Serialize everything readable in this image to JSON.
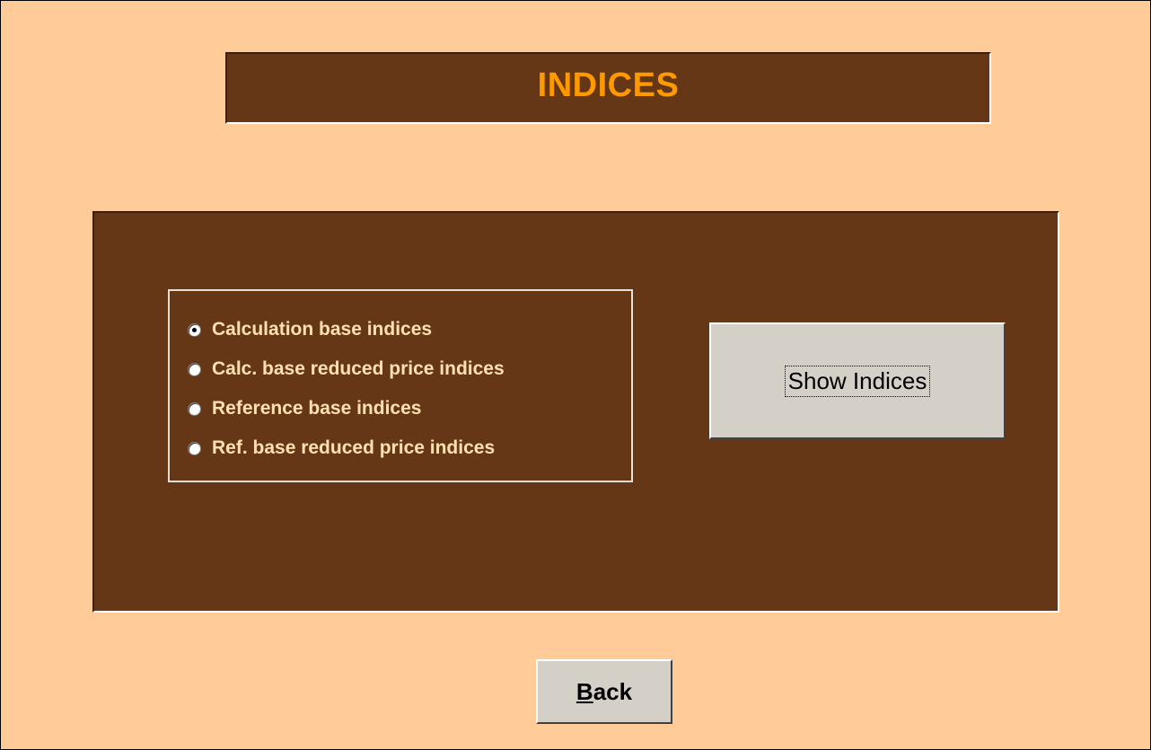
{
  "window": {
    "background": "#ffcc99"
  },
  "header": {
    "title": "INDICES",
    "title_color": "#ff9900",
    "banner_color": "#663717"
  },
  "panel": {
    "background": "#663717"
  },
  "options": {
    "label_color": "#ffe0b3",
    "selected_index": 0,
    "items": [
      {
        "label": "Calculation base indices",
        "checked": true
      },
      {
        "label": "Calc. base reduced price indices",
        "checked": false
      },
      {
        "label": "Reference base indices",
        "checked": false
      },
      {
        "label": "Ref. base reduced price indices",
        "checked": false
      }
    ]
  },
  "buttons": {
    "show_indices": "Show Indices",
    "back_accel": "B",
    "back_rest": "ack"
  }
}
